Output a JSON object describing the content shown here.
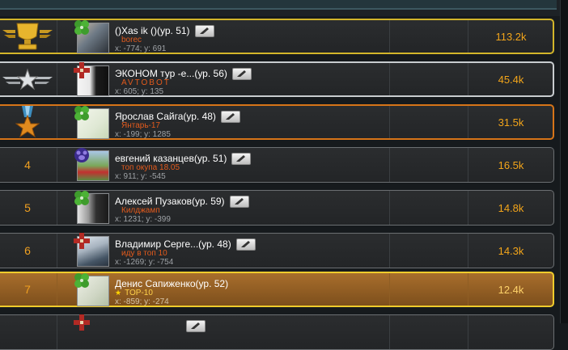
{
  "colors": {
    "gold_border": "#d2b52a",
    "silver_border": "#c8cccf",
    "bronze_border": "#d67418",
    "highlight_border": "#f0cc2c",
    "score": "#f3a51a",
    "clan": "#e25a1c"
  },
  "rows": [
    {
      "rank": "",
      "rank_icon": "gold-trophy-icon",
      "badge_icon": "green-clover-badge-icon",
      "name": "()Xas ik ()(ур. 51)",
      "clan": "borec",
      "coords": "x: -774; y: 691",
      "score": "113.2k"
    },
    {
      "rank": "",
      "rank_icon": "silver-winged-star-icon",
      "badge_icon": "red-cross-badge-icon",
      "name": "ЭКОНОМ тур -е...(ур. 56)",
      "clan": "AVTOBOT",
      "coords": "x: 605; y: 135",
      "score": "45.4k"
    },
    {
      "rank": "",
      "rank_icon": "bronze-star-medal-icon",
      "badge_icon": "green-clover-badge-icon",
      "name": "Ярослав Сайга(ур. 48)",
      "clan": "Янтарь-17",
      "coords": "x: -199; y: 1285",
      "score": "31.5k"
    },
    {
      "rank": "4",
      "rank_icon": "",
      "badge_icon": "purple-paw-badge-icon",
      "name": "евгений казанцев(ур. 51)",
      "clan": "топ окупа 18.05",
      "coords": "x: 911; y: -545",
      "score": "16.5k"
    },
    {
      "rank": "5",
      "rank_icon": "",
      "badge_icon": "green-clover-badge-icon",
      "name": "Алексей Пузаков(ур. 59)",
      "clan": "Килджамп",
      "coords": "x: 1231; y: -399",
      "score": "14.8k"
    },
    {
      "rank": "6",
      "rank_icon": "",
      "badge_icon": "red-cross-badge-icon",
      "name": "Владимир Серге...(ур. 48)",
      "clan": "иду в топ 10",
      "coords": "x: -1269; y: -754",
      "score": "14.3k"
    },
    {
      "rank": "7",
      "rank_icon": "",
      "badge_icon": "green-clover-badge-icon",
      "name": "Денис Сапиженко(ур. 52)",
      "clan": "TOP-10",
      "coords": "x: -859; y: -274",
      "score": "12.4k"
    },
    {
      "rank": "",
      "rank_icon": "",
      "badge_icon": "red-cross-badge-icon",
      "name": "",
      "clan": "",
      "coords": "",
      "score": ""
    }
  ]
}
